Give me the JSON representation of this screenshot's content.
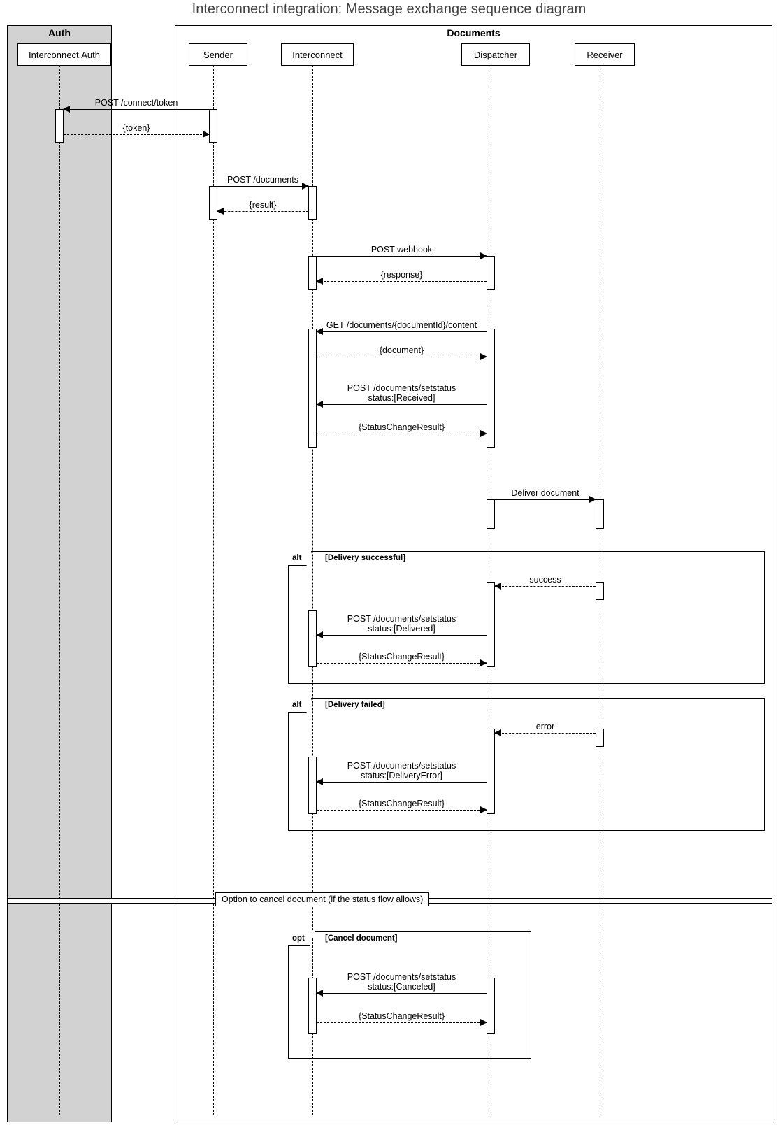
{
  "title": "Interconnect integration: Message exchange sequence diagram",
  "lanes": {
    "auth": "Auth",
    "documents": "Documents"
  },
  "participants": {
    "auth": "Interconnect.Auth",
    "sender": "Sender",
    "interconnect": "Interconnect",
    "dispatcher": "Dispatcher",
    "receiver": "Receiver"
  },
  "messages": {
    "m1": "POST /connect/token",
    "m2": "{token}",
    "m3": "POST /documents",
    "m4": "{result}",
    "m5": "POST webhook",
    "m6": "{response}",
    "m7": "GET /documents/{documentId}/content",
    "m8": "{document}",
    "m9": "POST /documents/setstatus\nstatus:[Received]",
    "m10": "{StatusChangeResult}",
    "m11": "Deliver document",
    "m12": "success",
    "m13": "POST /documents/setstatus\nstatus:[Delivered]",
    "m14": "{StatusChangeResult}",
    "m15": "error",
    "m16": "POST /documents/setstatus\nstatus:[DeliveryError]",
    "m17": "{StatusChangeResult}",
    "m18": "POST /documents/setstatus\nstatus:[Canceled]",
    "m19": "{StatusChangeResult}"
  },
  "frames": {
    "alt1": {
      "tag": "alt",
      "guard": "[Delivery successful]"
    },
    "alt2": {
      "tag": "alt",
      "guard": "[Delivery failed]"
    },
    "opt": {
      "tag": "opt",
      "guard": "[Cancel document]"
    }
  },
  "divider": "Option to cancel document (if the status flow allows)"
}
